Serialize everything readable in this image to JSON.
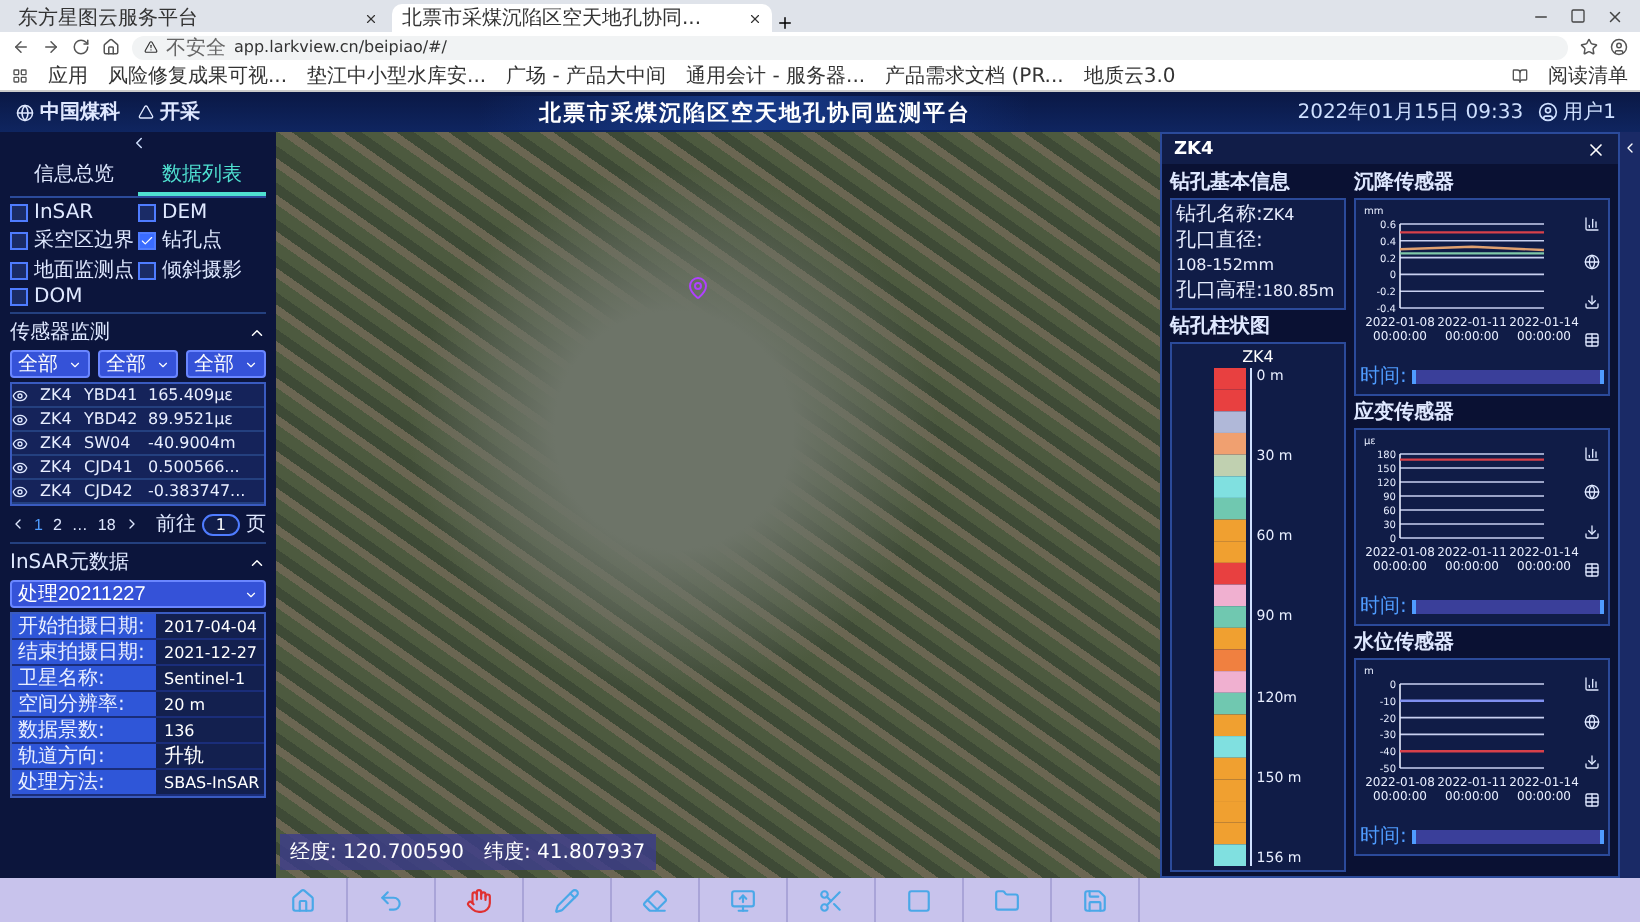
{
  "browser": {
    "tabs": [
      {
        "title": "东方星图云服务平台",
        "selected": false
      },
      {
        "title": "北票市采煤沉陷区空天地孔协同...",
        "selected": true
      }
    ],
    "security": "不安全",
    "url": "app.larkview.cn/beipiao/#/",
    "bookmarks": [
      "应用",
      "风险修复成果可视...",
      "垫江中小型水库安...",
      "广场 - 产品大中间",
      "通用会计 - 服务器...",
      "产品需求文档 (PR...",
      "地质云3.0"
    ],
    "reading_list": "阅读清单"
  },
  "header": {
    "logos": [
      "中国煤科",
      "开采"
    ],
    "title": "北票市采煤沉陷区空天地孔协同监测平台",
    "datetime": "2022年01月15日  09:33",
    "user": "用户1"
  },
  "left_panel": {
    "tabs": [
      {
        "label": "信息总览",
        "selected": false
      },
      {
        "label": "数据列表",
        "selected": true
      }
    ],
    "layers": [
      {
        "label": "InSAR",
        "checked": false
      },
      {
        "label": "DEM",
        "checked": false
      },
      {
        "label": "采空区边界",
        "checked": false
      },
      {
        "label": "钻孔点",
        "checked": true
      },
      {
        "label": "地面监测点",
        "checked": false
      },
      {
        "label": "倾斜摄影",
        "checked": false
      },
      {
        "label": "DOM",
        "checked": false
      }
    ],
    "sensor_monitoring": {
      "title": "传感器监测",
      "expanded": true,
      "filters": [
        "全部",
        "全部",
        "全部"
      ],
      "rows": [
        {
          "hole": "ZK4",
          "sensor": "YBD41",
          "value": "165.409με"
        },
        {
          "hole": "ZK4",
          "sensor": "YBD42",
          "value": "89.9521με"
        },
        {
          "hole": "ZK4",
          "sensor": "SW04",
          "value": "-40.9004m"
        },
        {
          "hole": "ZK4",
          "sensor": "CJD41",
          "value": "0.500566..."
        },
        {
          "hole": "ZK4",
          "sensor": "CJD42",
          "value": "-0.383747..."
        }
      ],
      "pages": [
        {
          "label": "1",
          "selected": true
        },
        {
          "label": "2",
          "selected": false
        },
        {
          "label": "…",
          "selected": false
        },
        {
          "label": "18",
          "selected": false
        }
      ],
      "goto_label": "前往",
      "goto_value": "1",
      "goto_unit": "页"
    },
    "insar": {
      "title": "InSAR元数据",
      "expanded": true,
      "dataset": "处理20211227",
      "rows": [
        {
          "label": "开始拍摄日期:",
          "value": "2017-04-04"
        },
        {
          "label": "结束拍摄日期:",
          "value": "2021-12-27"
        },
        {
          "label": "卫星名称:",
          "value": "Sentinel-1"
        },
        {
          "label": "空间分辨率:",
          "value": "20 m"
        },
        {
          "label": "数据景数:",
          "value": "136"
        },
        {
          "label": "轨道方向:",
          "value": "升轨"
        },
        {
          "label": "处理方法:",
          "value": "SBAS-InSAR"
        }
      ]
    }
  },
  "map": {
    "longitude": "经度: 120.700590",
    "latitude": "纬度: 41.807937"
  },
  "borehole": {
    "title": "ZK4",
    "basic_title": "钻孔基本信息",
    "info": [
      {
        "label": "钻孔名称:",
        "value": "ZK4"
      },
      {
        "label": "孔口直径:",
        "value": "108-152mm"
      },
      {
        "label": "孔口高程:",
        "value": "180.85m"
      }
    ],
    "column_title": "钻孔柱状图",
    "column_name": "ZK4",
    "depths": [
      "0 m",
      "30 m",
      "60 m",
      "90 m",
      "120m",
      "150 m",
      "156 m"
    ]
  },
  "sensors": [
    {
      "title": "沉降传感器",
      "time_label": "时间:",
      "level": 1,
      "chart_data": {
        "type": "line",
        "grid": true,
        "ylabel": "mm",
        "categories": [
          "2022-01-08 00:00:00",
          "2022-01-11 00:00:00",
          "2022-01-14 00:00:00"
        ],
        "yticks": [
          -0.4,
          -0.2,
          0,
          0.2,
          0.4,
          0.6
        ],
        "ylim": [
          -0.4,
          0.6
        ],
        "series": [
          {
            "color": "#d8404a",
            "values": [
              0.5,
              0.5,
              0.5
            ]
          },
          {
            "color": "#e0a070",
            "values": [
              0.3,
              0.33,
              0.29
            ]
          },
          {
            "color": "#7fc8a8",
            "values": [
              0.25,
              0.25,
              0.25
            ]
          }
        ]
      }
    },
    {
      "title": "应变传感器",
      "time_label": "时间:",
      "level": 1,
      "chart_data": {
        "type": "line",
        "grid": true,
        "ylabel": "με",
        "categories": [
          "2022-01-08 00:00:00",
          "2022-01-11 00:00:00",
          "2022-01-14 00:00:00"
        ],
        "yticks": [
          0,
          30,
          60,
          90,
          120,
          150,
          180
        ],
        "ylim": [
          0,
          180
        ],
        "series": [
          {
            "color": "#d8404a",
            "values": [
              168,
              168,
              168
            ]
          }
        ]
      }
    },
    {
      "title": "水位传感器",
      "time_label": "时间:",
      "level": 1,
      "chart_data": {
        "type": "line",
        "grid": true,
        "ylabel": "m",
        "categories": [
          "2022-01-08 00:00:00",
          "2022-01-11 00:00:00",
          "2022-01-14 00:00:00"
        ],
        "yticks": [
          -50,
          -40,
          -30,
          -20,
          -10,
          0
        ],
        "ylim": [
          -50,
          0
        ],
        "series": [
          {
            "color": "#d8404a",
            "values": [
              -40,
              -40,
              -40
            ]
          },
          {
            "color": "#8090f0",
            "values": [
              -10,
              -10,
              -10
            ]
          }
        ]
      }
    }
  ]
}
